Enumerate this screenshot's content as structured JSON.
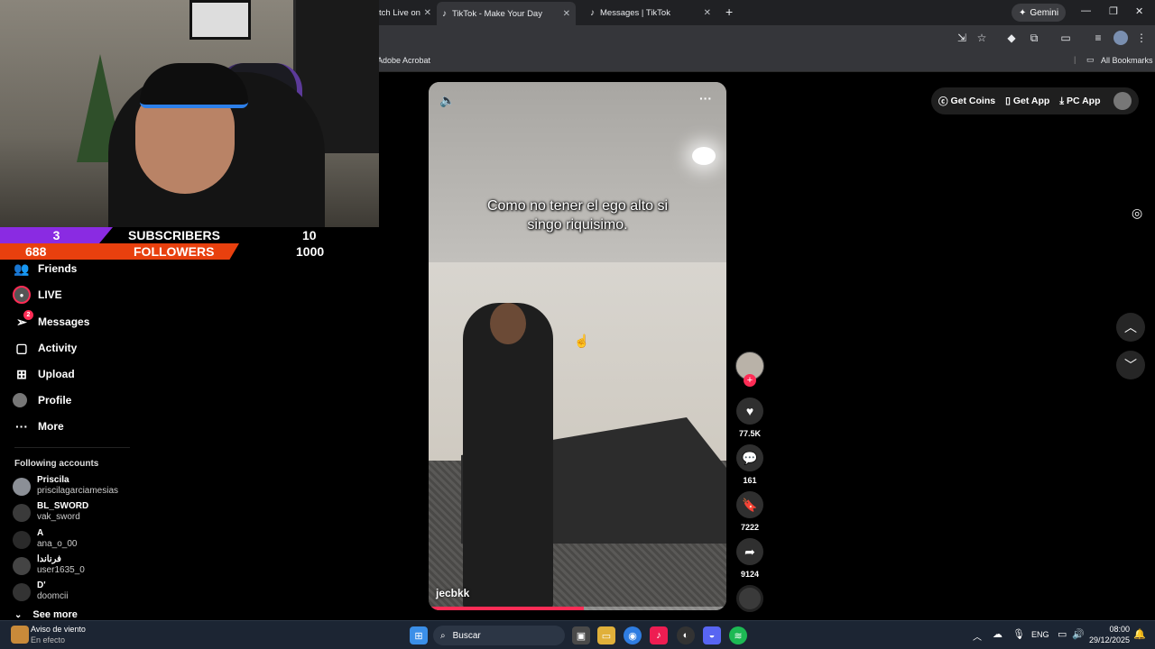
{
  "browser": {
    "tabs": [
      {
        "label": "tch Live on"
      },
      {
        "label": "TikTok - Make Your Day"
      },
      {
        "label": "Messages | TikTok"
      }
    ],
    "gemini_label": "Gemini",
    "bookmarks": {
      "left": "Adobe Acrobat",
      "right": "All Bookmarks"
    }
  },
  "overlay": {
    "subs_count": "3",
    "subs_label": "SUBSCRIBERS",
    "subs_goal": "10",
    "followers_count": "688",
    "followers_label": "FOLLOWERS",
    "followers_goal": "1000"
  },
  "sidebar": {
    "items": [
      {
        "label": "Friends"
      },
      {
        "label": "LIVE"
      },
      {
        "label": "Messages",
        "badge": "2"
      },
      {
        "label": "Activity"
      },
      {
        "label": "Upload"
      },
      {
        "label": "Profile"
      },
      {
        "label": "More"
      }
    ],
    "following_header": "Following accounts",
    "accounts": [
      {
        "name": "Priscila",
        "user": "priscilagarciamesias"
      },
      {
        "name": "BL_SWORD",
        "user": "vak_sword"
      },
      {
        "name": "A",
        "user": "ana_o_00"
      },
      {
        "name": "فرناندا",
        "user": "user1635_0"
      },
      {
        "name": "D'",
        "user": "doomcii"
      }
    ],
    "see_more": "See more"
  },
  "video": {
    "caption_line1": "Como no tener el ego alto si",
    "caption_line2": "singo riquisimo.",
    "author": "jecbkk",
    "progress": 0.52
  },
  "actions": {
    "likes": "77.5K",
    "comments": "161",
    "saves": "7222",
    "shares": "9124"
  },
  "topright": {
    "coins": "Get Coins",
    "app": "Get App",
    "pc": "PC App"
  },
  "taskbar": {
    "weather_title": "Aviso de viento",
    "weather_sub": "En efecto",
    "search_placeholder": "Buscar",
    "lang": "ENG",
    "time": "08:00",
    "date": "29/12/2025"
  },
  "colors": {
    "accent": "#fe2c55",
    "subs": "#8a2be2",
    "followers": "#e8400e"
  }
}
